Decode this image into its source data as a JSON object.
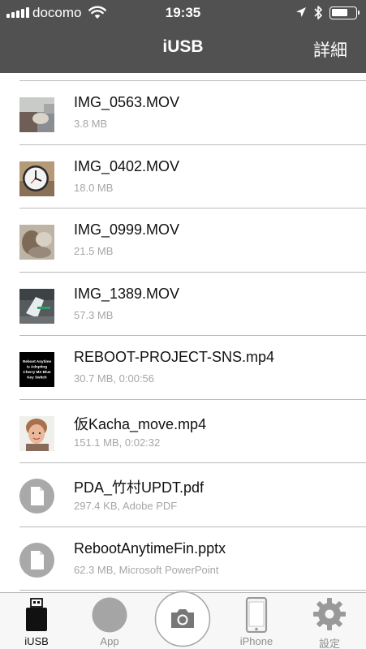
{
  "status_bar": {
    "carrier": "docomo",
    "time": "19:35",
    "battery_level": 0.7
  },
  "nav": {
    "title": "iUSB",
    "detail_button": "詳細"
  },
  "files": [
    {
      "name": "IMG_0563.MOV",
      "meta": "3.8 MB",
      "thumb": "video-thumbnail-icon"
    },
    {
      "name": "IMG_0402.MOV",
      "meta": "18.0 MB",
      "thumb": "clock-thumbnail-icon"
    },
    {
      "name": "IMG_0999.MOV",
      "meta": "21.5 MB",
      "thumb": "video-thumbnail-icon"
    },
    {
      "name": "IMG_1389.MOV",
      "meta": "57.3 MB",
      "thumb": "video-thumbnail-icon"
    },
    {
      "name": "REBOOT-PROJECT-SNS.mp4",
      "meta": "30.7 MB, 0:00:56",
      "thumb": "video-thumbnail-icon",
      "thumb_text": [
        "Reboot Anytime",
        "is Adopting",
        "Cherry MX Blue",
        "Key Switch"
      ]
    },
    {
      "name": "仮Kacha_move.mp4",
      "meta": "151.1 MB, 0:02:32",
      "thumb": "portrait-thumbnail-icon"
    },
    {
      "name": "PDA_竹村UPDT.pdf",
      "meta": "297.4 KB, Adobe PDF",
      "thumb": "document-icon"
    },
    {
      "name": "RebootAnytimeFin.pptx",
      "meta": "62.3 MB, Microsoft PowerPoint",
      "thumb": "document-icon"
    }
  ],
  "tabs": [
    {
      "label": "iUSB",
      "icon": "usb-drive-icon",
      "active": true
    },
    {
      "label": "App",
      "icon": "app-circle-icon",
      "active": false
    },
    {
      "label": "",
      "icon": "camera-icon",
      "active": false
    },
    {
      "label": "iPhone",
      "icon": "iphone-icon",
      "active": false
    },
    {
      "label": "設定",
      "icon": "gear-icon",
      "active": false
    }
  ],
  "colors": {
    "nav_background": "#515151",
    "separator": "#b9b9b9",
    "secondary_text": "#a6a6a6",
    "tab_inactive": "#8e8e8e"
  }
}
